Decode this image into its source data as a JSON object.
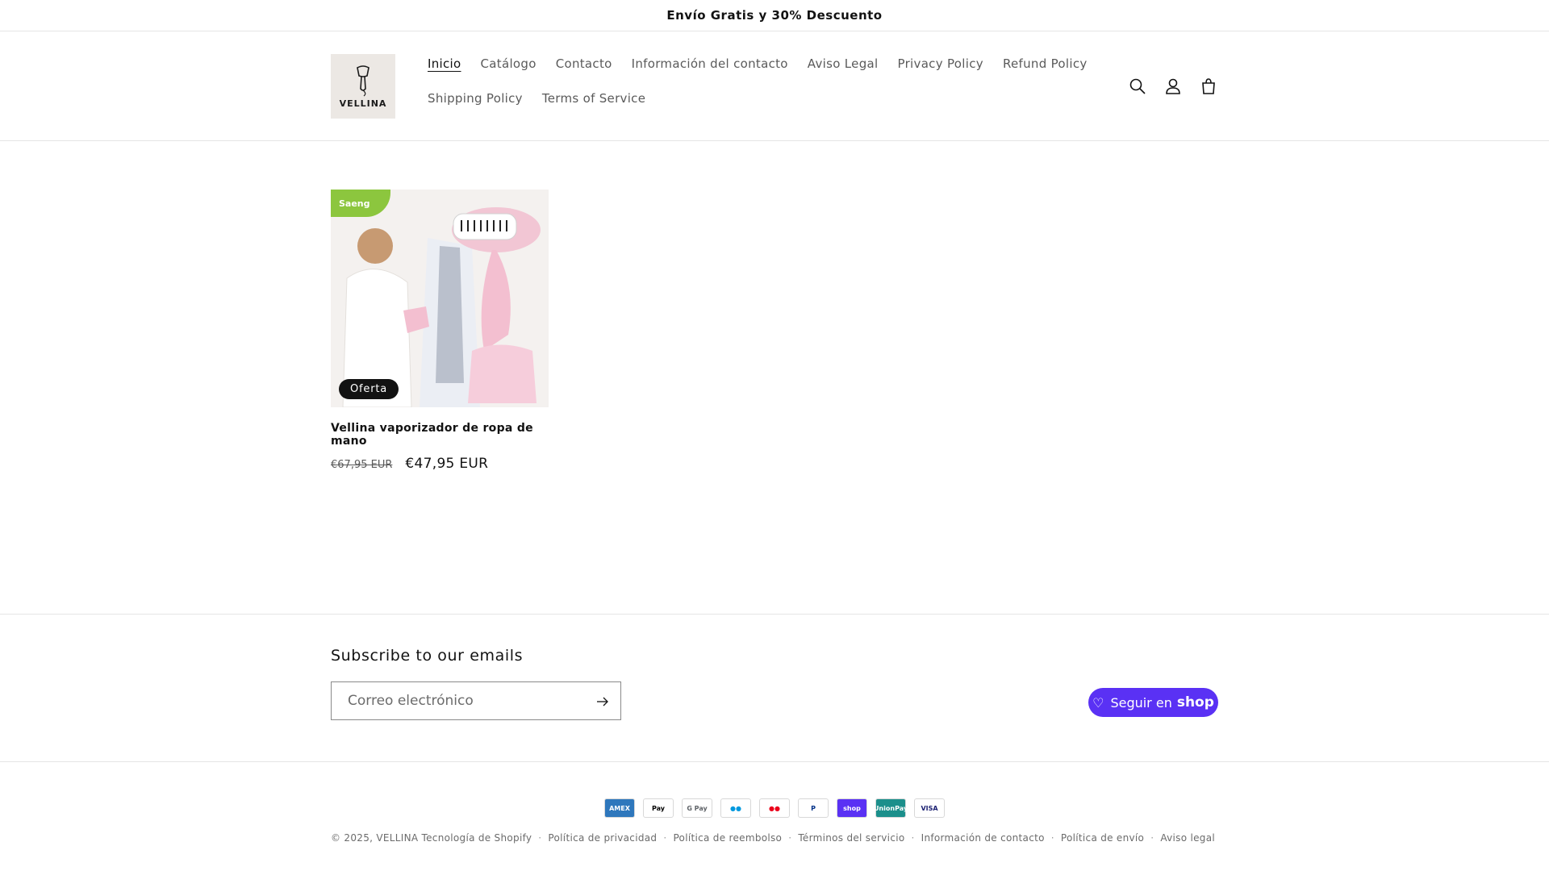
{
  "announcement": {
    "text": "Envío Gratis y 30% Descuento"
  },
  "header": {
    "logo_text": "VELLINA",
    "nav": [
      {
        "label": "Inicio",
        "active": true
      },
      {
        "label": "Catálogo"
      },
      {
        "label": "Contacto"
      },
      {
        "label": "Información del contacto"
      },
      {
        "label": "Aviso Legal"
      },
      {
        "label": "Privacy Policy"
      },
      {
        "label": "Refund Policy"
      },
      {
        "label": "Shipping Policy"
      },
      {
        "label": "Terms of Service"
      }
    ],
    "icons": [
      "search-icon",
      "account-icon",
      "cart-icon"
    ]
  },
  "product": {
    "badge": "Oferta",
    "brand_corner": "Saeng",
    "title": "Vellina vaporizador de ropa de mano",
    "price_old": "€67,95 EUR",
    "price_new": "€47,95 EUR"
  },
  "footer": {
    "subscribe_title": "Subscribe to our emails",
    "email_placeholder": "Correo electrónico",
    "shop_follow": {
      "prefix": "Seguir en",
      "brand": "shop"
    },
    "payments": [
      {
        "label": "AMEX",
        "bg": "#2e77bc",
        "fg": "#ffffff"
      },
      {
        "label": "Pay",
        "bg": "#ffffff",
        "fg": "#000000"
      },
      {
        "label": "G Pay",
        "bg": "#ffffff",
        "fg": "#5f6368"
      },
      {
        "label": "●●",
        "bg": "#ffffff",
        "fg": "#0099df"
      },
      {
        "label": "●●",
        "bg": "#ffffff",
        "fg": "#eb001b"
      },
      {
        "label": "P",
        "bg": "#ffffff",
        "fg": "#003087"
      },
      {
        "label": "shop",
        "bg": "#5a31f4",
        "fg": "#ffffff"
      },
      {
        "label": "UnionPay",
        "bg": "#1b8f8b",
        "fg": "#ffffff"
      },
      {
        "label": "VISA",
        "bg": "#ffffff",
        "fg": "#1a1f71"
      }
    ],
    "copyright_prefix": "© 2025,",
    "store_name": "VELLINA",
    "powered": "Tecnología de Shopify",
    "links": [
      "Política de privacidad",
      "Política de reembolso",
      "Términos del servicio",
      "Información de contacto",
      "Política de envío",
      "Aviso legal"
    ]
  },
  "colors": {
    "shop_purple": "#5a31f4",
    "text": "#121212",
    "muted": "#5a5a5a"
  }
}
